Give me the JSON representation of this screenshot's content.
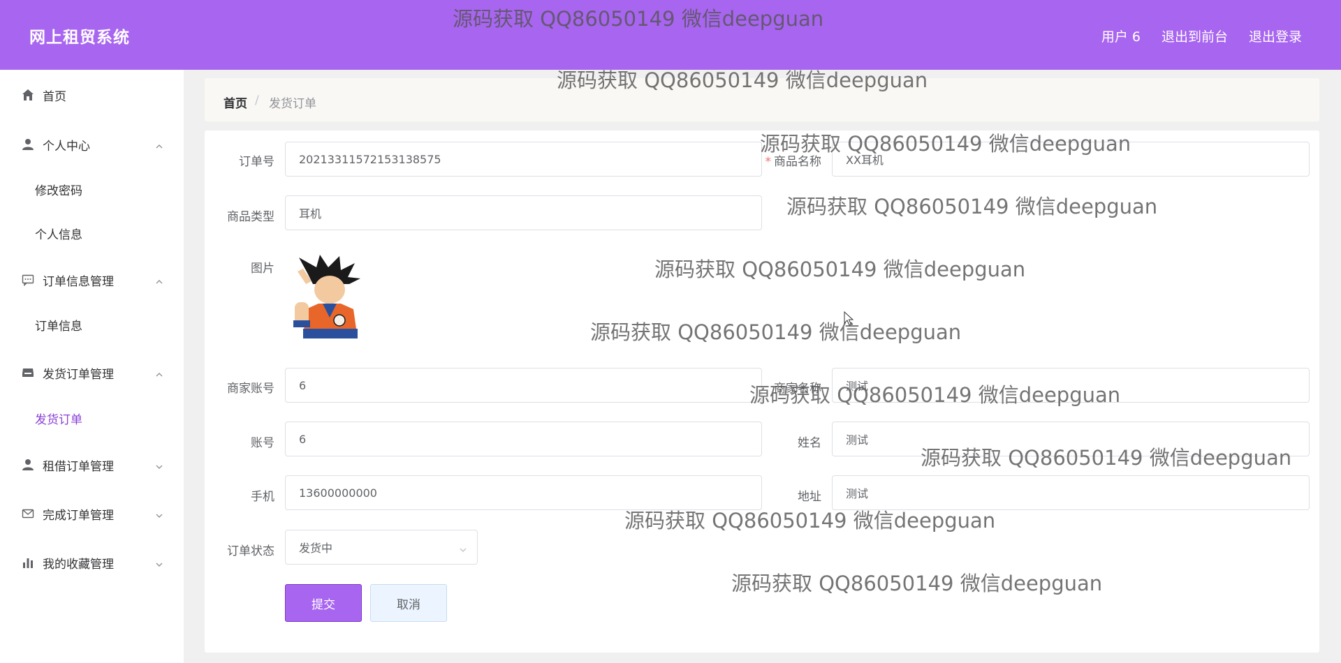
{
  "header": {
    "title": "网上租贸系统",
    "links": [
      "用户 6",
      "退出到前台",
      "退出登录"
    ]
  },
  "sidebar": {
    "home": "首页",
    "personal": {
      "label": "个人中心",
      "children": [
        "修改密码",
        "个人信息"
      ]
    },
    "order_info": {
      "label": "订单信息管理",
      "children": [
        "订单信息"
      ]
    },
    "ship_order": {
      "label": "发货订单管理",
      "children": [
        "发货订单"
      ]
    },
    "rent_order": {
      "label": "租借订单管理"
    },
    "done_order": {
      "label": "完成订单管理"
    },
    "favorites": {
      "label": "我的收藏管理"
    },
    "active_item": "发货订单"
  },
  "breadcrumb": {
    "home": "首页",
    "separator": "/",
    "current": "发货订单"
  },
  "form": {
    "order_no": {
      "label": "订单号",
      "value": "20213311572153138575"
    },
    "product_name": {
      "label": "商品名称",
      "required_mark": "*",
      "value": "XX耳机"
    },
    "product_type": {
      "label": "商品类型",
      "value": "耳机"
    },
    "image": {
      "label": "图片"
    },
    "merchant_account": {
      "label": "商家账号",
      "value": "6"
    },
    "merchant_name": {
      "label": "商家名称",
      "value": "测试"
    },
    "account": {
      "label": "账号",
      "value": "6"
    },
    "name": {
      "label": "姓名",
      "value": "测试"
    },
    "phone": {
      "label": "手机",
      "value": "13600000000"
    },
    "address": {
      "label": "地址",
      "value": "测试"
    },
    "status": {
      "label": "订单状态",
      "value": "发货中"
    },
    "submit_label": "提交",
    "cancel_label": "取消"
  },
  "watermark_text": "源码获取 QQ86050149 微信deepguan",
  "colors": {
    "header": "#a865f0",
    "active": "#8a3fd6",
    "submit": "#a865f0"
  }
}
